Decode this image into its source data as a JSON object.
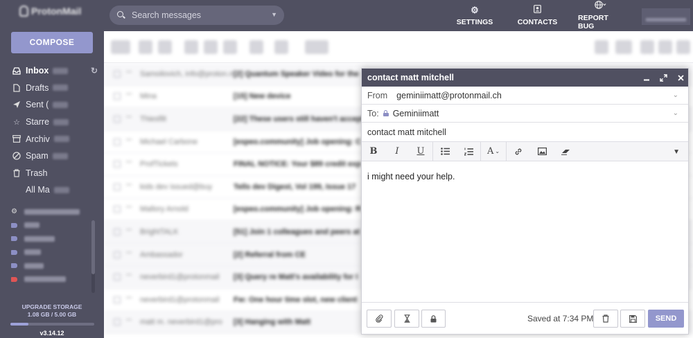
{
  "app": {
    "name": "ProtonMail",
    "version": "v3.14.12"
  },
  "sidebar": {
    "compose_label": "COMPOSE",
    "items": [
      {
        "label": "Inbox",
        "icon": "inbox-icon",
        "active": true
      },
      {
        "label": "Drafts",
        "icon": "drafts-icon"
      },
      {
        "label": "Sent (",
        "icon": "sent-icon"
      },
      {
        "label": "Starre",
        "icon": "star-icon"
      },
      {
        "label": "Archiv",
        "icon": "archive-icon"
      },
      {
        "label": "Spam",
        "icon": "spam-icon"
      },
      {
        "label": "Trash",
        "icon": "trash-icon"
      },
      {
        "label": "All Ma",
        "icon": ""
      }
    ],
    "folder_tag_colors": [
      "#8c8fc4",
      "#8c8fc4",
      "#8c8fc4",
      "#8c8fc4",
      "#e05555"
    ],
    "storage": {
      "label": "UPGRADE STORAGE",
      "usage": "1.08 GB / 5.00 GB",
      "fraction": 0.216
    }
  },
  "header": {
    "search_placeholder": "Search messages",
    "nav": [
      {
        "label": "SETTINGS",
        "icon": "settings-icon"
      },
      {
        "label": "CONTACTS",
        "icon": "contacts-icon"
      },
      {
        "label": "REPORT BUG",
        "icon": "globe-icon"
      }
    ]
  },
  "messages": [
    {
      "sender": "Samoilovich, info@proton.me",
      "subject": "[2] Quantum Speaker Video for the"
    },
    {
      "sender": "Mina",
      "subject": "[15] New device"
    },
    {
      "sender": "Thiesfilt",
      "subject": "[22] These users still haven't accept"
    },
    {
      "sender": "Michael Carbone",
      "subject": "[espeo.community] Job opening: C"
    },
    {
      "sender": "ProfTickets",
      "subject": "FINAL NOTICE: Your $89 credit exp"
    },
    {
      "sender": "kids dev issued@buy",
      "subject": "Tells dev Digest, Vol 199, Issue 17"
    },
    {
      "sender": "Mallory Arnold",
      "subject": "[espeo.community] Job opening: R"
    },
    {
      "sender": "BrightTALK",
      "subject": "[51] Join 1 colleagues and peers at"
    },
    {
      "sender": "Ambassador",
      "subject": "[2] Referral from CE"
    },
    {
      "sender": "neverbird1@protonmail",
      "subject": "[3] Query re Matt's availability for I"
    },
    {
      "sender": "neverbird1@protonmail",
      "subject": "Fw: One hour time slot, new client"
    },
    {
      "sender": "matt m. neverbird1@pro",
      "subject": "[3] Hanging with Matt"
    }
  ],
  "composer": {
    "title": "contact matt mitchell",
    "from_label": "From",
    "from_value": "geminiimatt@protonmail.ch",
    "to_label": "To:",
    "to_value": "Geminiimatt",
    "subject": "contact matt mitchell",
    "body": "i might need your help.",
    "saved_text": "Saved at 7:34 PM",
    "send_label": "SEND",
    "toolbar": [
      "bold-icon",
      "italic-icon",
      "underline-icon",
      "bulleted-list-icon",
      "numbered-list-icon",
      "font-size-icon",
      "link-icon",
      "image-icon",
      "eraser-icon"
    ]
  }
}
